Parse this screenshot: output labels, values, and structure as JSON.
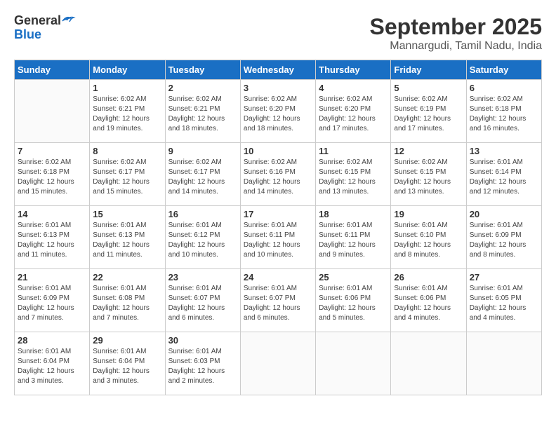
{
  "header": {
    "logo_line1": "General",
    "logo_line2": "Blue",
    "title": "September 2025",
    "subtitle": "Mannargudi, Tamil Nadu, India"
  },
  "calendar": {
    "days_of_week": [
      "Sunday",
      "Monday",
      "Tuesday",
      "Wednesday",
      "Thursday",
      "Friday",
      "Saturday"
    ],
    "weeks": [
      [
        {
          "day": "",
          "info": ""
        },
        {
          "day": "1",
          "info": "Sunrise: 6:02 AM\nSunset: 6:21 PM\nDaylight: 12 hours\nand 19 minutes."
        },
        {
          "day": "2",
          "info": "Sunrise: 6:02 AM\nSunset: 6:21 PM\nDaylight: 12 hours\nand 18 minutes."
        },
        {
          "day": "3",
          "info": "Sunrise: 6:02 AM\nSunset: 6:20 PM\nDaylight: 12 hours\nand 18 minutes."
        },
        {
          "day": "4",
          "info": "Sunrise: 6:02 AM\nSunset: 6:20 PM\nDaylight: 12 hours\nand 17 minutes."
        },
        {
          "day": "5",
          "info": "Sunrise: 6:02 AM\nSunset: 6:19 PM\nDaylight: 12 hours\nand 17 minutes."
        },
        {
          "day": "6",
          "info": "Sunrise: 6:02 AM\nSunset: 6:18 PM\nDaylight: 12 hours\nand 16 minutes."
        }
      ],
      [
        {
          "day": "7",
          "info": "Sunrise: 6:02 AM\nSunset: 6:18 PM\nDaylight: 12 hours\nand 15 minutes."
        },
        {
          "day": "8",
          "info": "Sunrise: 6:02 AM\nSunset: 6:17 PM\nDaylight: 12 hours\nand 15 minutes."
        },
        {
          "day": "9",
          "info": "Sunrise: 6:02 AM\nSunset: 6:17 PM\nDaylight: 12 hours\nand 14 minutes."
        },
        {
          "day": "10",
          "info": "Sunrise: 6:02 AM\nSunset: 6:16 PM\nDaylight: 12 hours\nand 14 minutes."
        },
        {
          "day": "11",
          "info": "Sunrise: 6:02 AM\nSunset: 6:15 PM\nDaylight: 12 hours\nand 13 minutes."
        },
        {
          "day": "12",
          "info": "Sunrise: 6:02 AM\nSunset: 6:15 PM\nDaylight: 12 hours\nand 13 minutes."
        },
        {
          "day": "13",
          "info": "Sunrise: 6:01 AM\nSunset: 6:14 PM\nDaylight: 12 hours\nand 12 minutes."
        }
      ],
      [
        {
          "day": "14",
          "info": "Sunrise: 6:01 AM\nSunset: 6:13 PM\nDaylight: 12 hours\nand 11 minutes."
        },
        {
          "day": "15",
          "info": "Sunrise: 6:01 AM\nSunset: 6:13 PM\nDaylight: 12 hours\nand 11 minutes."
        },
        {
          "day": "16",
          "info": "Sunrise: 6:01 AM\nSunset: 6:12 PM\nDaylight: 12 hours\nand 10 minutes."
        },
        {
          "day": "17",
          "info": "Sunrise: 6:01 AM\nSunset: 6:11 PM\nDaylight: 12 hours\nand 10 minutes."
        },
        {
          "day": "18",
          "info": "Sunrise: 6:01 AM\nSunset: 6:11 PM\nDaylight: 12 hours\nand 9 minutes."
        },
        {
          "day": "19",
          "info": "Sunrise: 6:01 AM\nSunset: 6:10 PM\nDaylight: 12 hours\nand 8 minutes."
        },
        {
          "day": "20",
          "info": "Sunrise: 6:01 AM\nSunset: 6:09 PM\nDaylight: 12 hours\nand 8 minutes."
        }
      ],
      [
        {
          "day": "21",
          "info": "Sunrise: 6:01 AM\nSunset: 6:09 PM\nDaylight: 12 hours\nand 7 minutes."
        },
        {
          "day": "22",
          "info": "Sunrise: 6:01 AM\nSunset: 6:08 PM\nDaylight: 12 hours\nand 7 minutes."
        },
        {
          "day": "23",
          "info": "Sunrise: 6:01 AM\nSunset: 6:07 PM\nDaylight: 12 hours\nand 6 minutes."
        },
        {
          "day": "24",
          "info": "Sunrise: 6:01 AM\nSunset: 6:07 PM\nDaylight: 12 hours\nand 6 minutes."
        },
        {
          "day": "25",
          "info": "Sunrise: 6:01 AM\nSunset: 6:06 PM\nDaylight: 12 hours\nand 5 minutes."
        },
        {
          "day": "26",
          "info": "Sunrise: 6:01 AM\nSunset: 6:06 PM\nDaylight: 12 hours\nand 4 minutes."
        },
        {
          "day": "27",
          "info": "Sunrise: 6:01 AM\nSunset: 6:05 PM\nDaylight: 12 hours\nand 4 minutes."
        }
      ],
      [
        {
          "day": "28",
          "info": "Sunrise: 6:01 AM\nSunset: 6:04 PM\nDaylight: 12 hours\nand 3 minutes."
        },
        {
          "day": "29",
          "info": "Sunrise: 6:01 AM\nSunset: 6:04 PM\nDaylight: 12 hours\nand 3 minutes."
        },
        {
          "day": "30",
          "info": "Sunrise: 6:01 AM\nSunset: 6:03 PM\nDaylight: 12 hours\nand 2 minutes."
        },
        {
          "day": "",
          "info": ""
        },
        {
          "day": "",
          "info": ""
        },
        {
          "day": "",
          "info": ""
        },
        {
          "day": "",
          "info": ""
        }
      ]
    ]
  }
}
